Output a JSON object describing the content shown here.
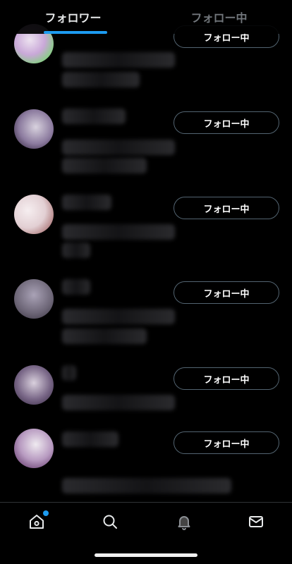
{
  "tabs": [
    {
      "label": "フォロワー",
      "active": true
    },
    {
      "label": "フォロー中",
      "active": false
    }
  ],
  "followers": [
    {
      "button_label": "フォロー中",
      "avatar_colors": [
        "#d9c7e0",
        "#7fd27a"
      ]
    },
    {
      "button_label": "フォロー中",
      "avatar_colors": [
        "#c8c3cf",
        "#6d4f8c"
      ]
    },
    {
      "button_label": "フォロー中",
      "avatar_colors": [
        "#f2e9ec",
        "#9a5a5a"
      ]
    },
    {
      "button_label": "フォロー中",
      "avatar_colors": [
        "#6c6576",
        "#a9a2b6"
      ]
    },
    {
      "button_label": "フォロー中",
      "avatar_colors": [
        "#bdb5c4",
        "#4d3d57"
      ]
    },
    {
      "button_label": "フォロー中",
      "avatar_colors": [
        "#e8e3ea",
        "#5b2f63"
      ]
    }
  ],
  "bottom_nav": [
    {
      "icon": "home-icon",
      "notification_dot": true
    },
    {
      "icon": "search-icon",
      "notification_dot": false
    },
    {
      "icon": "bell-icon",
      "notification_dot": false
    },
    {
      "icon": "mail-icon",
      "notification_dot": false
    }
  ],
  "colors": {
    "accent": "#1d9bf0",
    "background": "#000000",
    "button_border": "#536471"
  }
}
